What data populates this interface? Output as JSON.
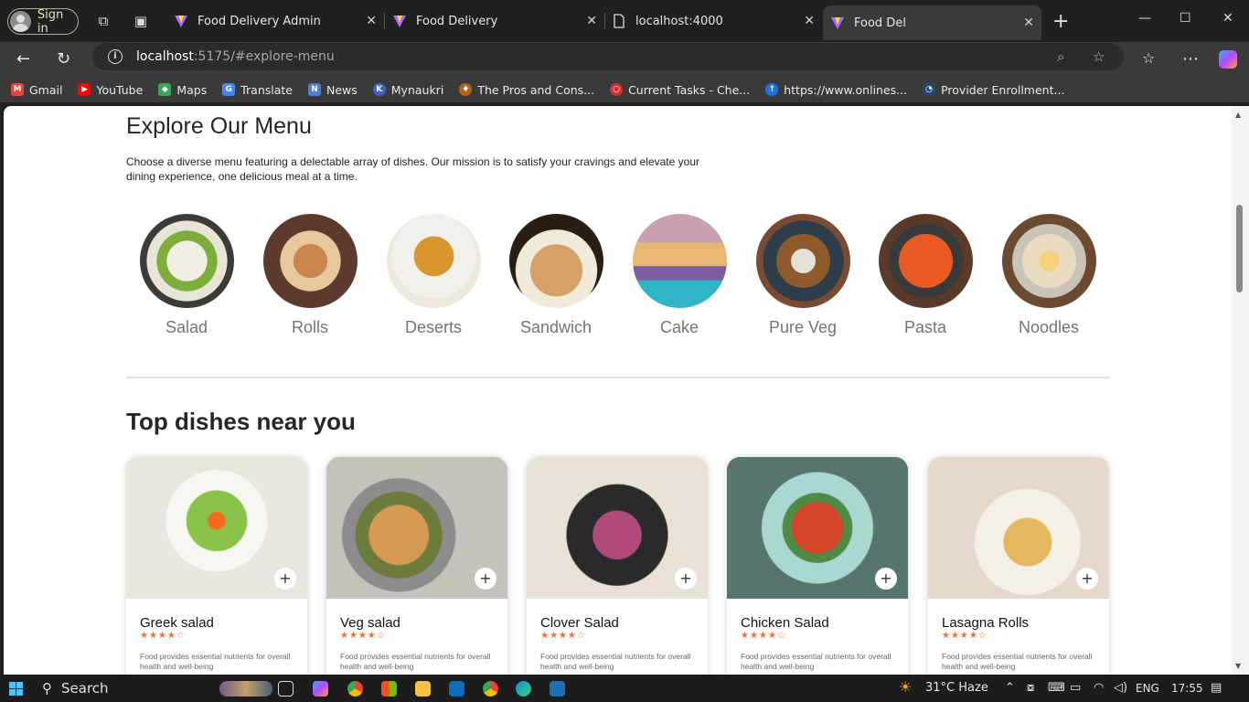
{
  "browser": {
    "signin_label": "Sign in",
    "tabs": [
      {
        "title": "Food Delivery Admin",
        "active": false
      },
      {
        "title": "Food Delivery",
        "active": false
      },
      {
        "title": "localhost:4000",
        "active": false
      },
      {
        "title": "Food Del",
        "active": true
      }
    ],
    "url_host": "localhost",
    "url_rest": ":5175/#explore-menu",
    "bookmarks": [
      {
        "label": "Gmail",
        "color": "#ea4335"
      },
      {
        "label": "YouTube",
        "color": "#ff0000"
      },
      {
        "label": "Maps",
        "color": "#34a853"
      },
      {
        "label": "Translate",
        "color": "#4285f4"
      },
      {
        "label": "News",
        "color": "#4a7fd4"
      },
      {
        "label": "Mynaukri",
        "color": "#3b63c8"
      },
      {
        "label": "The Pros and Cons...",
        "color": "#b5651d"
      },
      {
        "label": "Current Tasks - Che...",
        "color": "#d32f2f"
      },
      {
        "label": "https://www.onlines...",
        "color": "#1a73e8"
      },
      {
        "label": "Provider Enrollment...",
        "color": "#1e88e5"
      }
    ]
  },
  "explore": {
    "title": "Explore Our Menu",
    "description": "Choose a diverse menu featuring a delectable array of dishes. Our mission is to satisfy your cravings and elevate your dining experience, one delicious meal at a time.",
    "categories": [
      "Salad",
      "Rolls",
      "Deserts",
      "Sandwich",
      "Cake",
      "Pure Veg",
      "Pasta",
      "Noodles"
    ]
  },
  "top_dishes": {
    "title": "Top dishes near you",
    "items": [
      {
        "name": "Greek salad",
        "rating": "★★★★☆",
        "description": "Food provides essential nutrients for overall health and well-being"
      },
      {
        "name": "Veg salad",
        "rating": "★★★★☆",
        "description": "Food provides essential nutrients for overall health and well-being"
      },
      {
        "name": "Clover Salad",
        "rating": "★★★★☆",
        "description": "Food provides essential nutrients for overall health and well-being"
      },
      {
        "name": "Chicken Salad",
        "rating": "★★★★☆",
        "description": "Food provides essential nutrients for overall health and well-being"
      },
      {
        "name": "Lasagna Rolls",
        "rating": "★★★★☆",
        "description": "Food provides essential nutrients for overall health and well-being"
      }
    ]
  },
  "taskbar": {
    "search_label": "Search",
    "weather": "31°C  Haze",
    "language": "ENG",
    "time": "17:55"
  }
}
